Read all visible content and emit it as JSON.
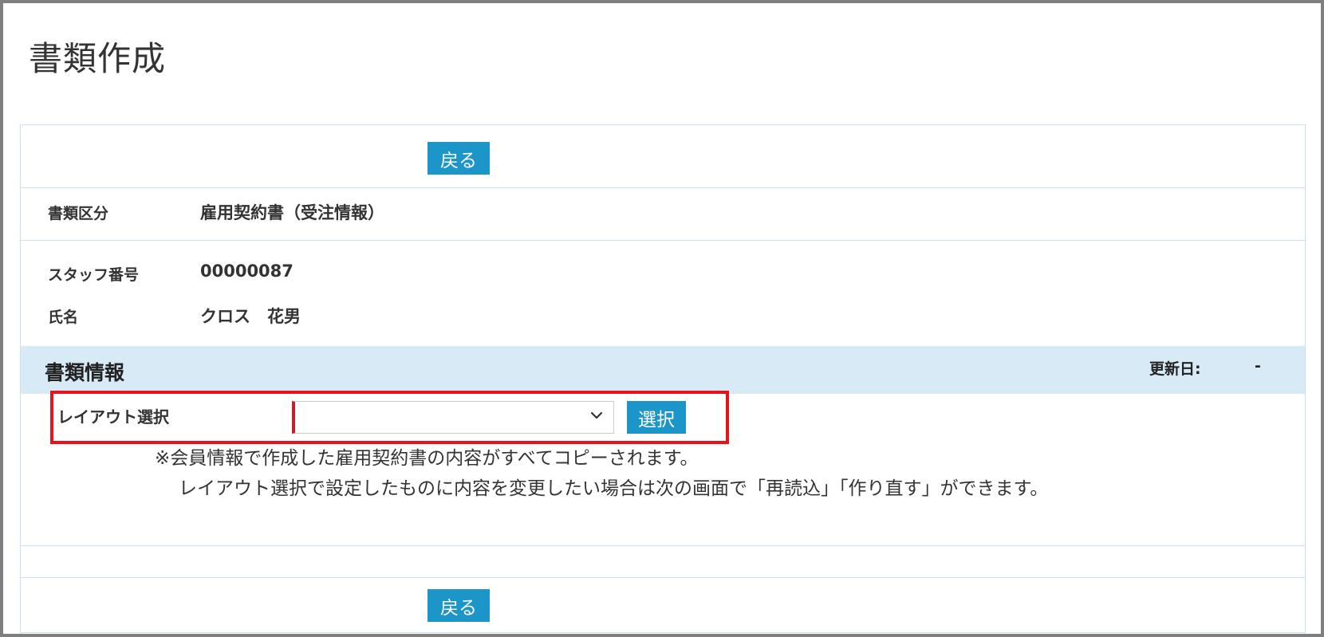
{
  "page": {
    "title": "書類作成"
  },
  "buttons": {
    "back_top": "戻る",
    "back_bottom": "戻る",
    "select": "選択"
  },
  "document_type": {
    "label": "書類区分",
    "value": "雇用契約書（受注情報）"
  },
  "staff": {
    "number_label": "スタッフ番号",
    "number_value": "00000087",
    "name_label": "氏名",
    "name_value": "クロス　花男"
  },
  "document_info": {
    "title": "書類情報",
    "updated_label": "更新日:",
    "updated_value": "-",
    "layout_label": "レイアウト選択",
    "layout_selected": "",
    "note_line1": "※会員情報で作成した雇用契約書の内容がすべてコピーされます。",
    "note_line2": "レイアウト選択で設定したものに内容を変更したい場合は次の画面で「再読込」「作り直す」ができます。"
  },
  "colors": {
    "accent_button": "#1c95c9",
    "section_bg": "#d9eaf7",
    "highlight_border": "#e8121b",
    "panel_border": "#c9e1f3"
  }
}
